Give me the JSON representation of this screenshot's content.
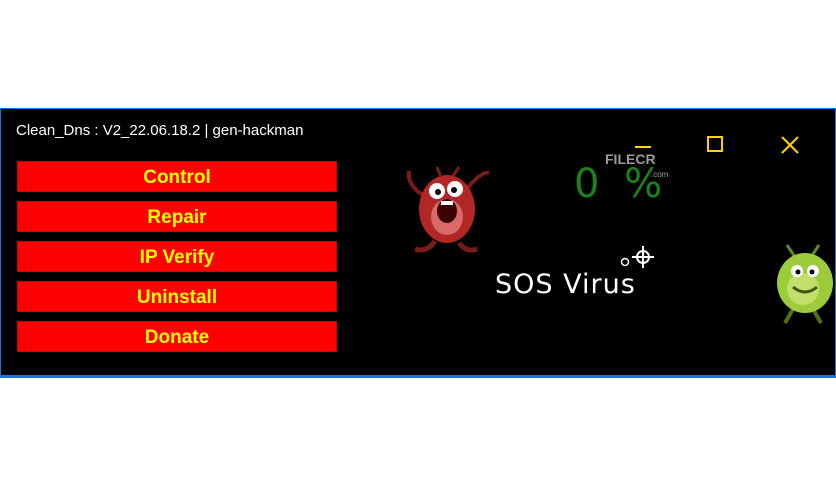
{
  "window": {
    "title": "Clean_Dns : V2_22.06.18.2 | gen-hackman"
  },
  "menu": {
    "buttons": [
      {
        "label": "Control"
      },
      {
        "label": "Repair"
      },
      {
        "label": "IP Verify"
      },
      {
        "label": "Uninstall"
      },
      {
        "label": "Donate"
      }
    ]
  },
  "controls": {
    "minimize_icon": "minimize-icon",
    "maximize_icon": "maximize-icon",
    "close_icon": "close-icon"
  },
  "status": {
    "progress_text": "0 %",
    "progress_value": 0,
    "app_name": "SOS Virus"
  },
  "watermark": {
    "brand": "FILECR",
    "domain": ".com"
  },
  "colors": {
    "window_bg": "#000000",
    "border": "#1e73d8",
    "button_bg": "#ff0000",
    "button_text": "#ffff00",
    "window_controls": "#ffd200",
    "progress": "#1f8f1f"
  }
}
